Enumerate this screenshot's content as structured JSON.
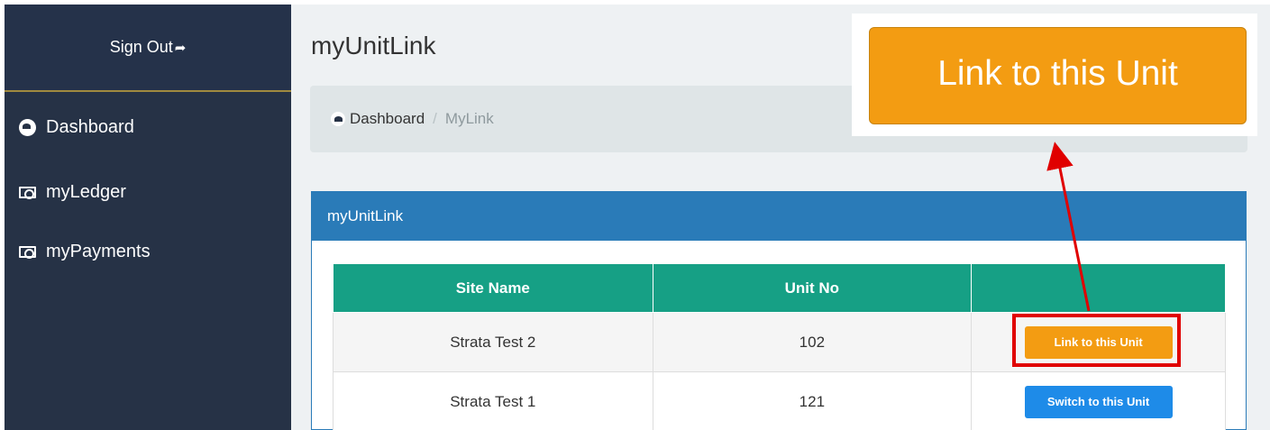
{
  "sidebar": {
    "signout_label": "Sign Out",
    "signout_icon": "sign-out-icon",
    "items": [
      {
        "label": "Dashboard",
        "icon": "dashboard-gauge-icon"
      },
      {
        "label": "myLedger",
        "icon": "money-icon"
      },
      {
        "label": "myPayments",
        "icon": "money-icon"
      }
    ]
  },
  "page": {
    "title": "myUnitLink",
    "breadcrumb": {
      "home": "Dashboard",
      "separator": "/",
      "current": "MyLink"
    }
  },
  "panel": {
    "title": "myUnitLink",
    "table": {
      "headers": [
        "Site Name",
        "Unit No",
        ""
      ],
      "rows": [
        {
          "site": "Strata Test 2",
          "unit": "102",
          "action": "Link to this Unit"
        },
        {
          "site": "Strata Test 1",
          "unit": "121",
          "action": "Switch to this Unit"
        }
      ]
    }
  },
  "callout": {
    "label": "Link to this Unit"
  },
  "colors": {
    "sidebar": "#263246",
    "panel_header": "#2a7bb8",
    "table_header": "#16a085",
    "link_button": "#f39c12",
    "switch_button": "#1e8be8",
    "highlight": "#e00000"
  }
}
